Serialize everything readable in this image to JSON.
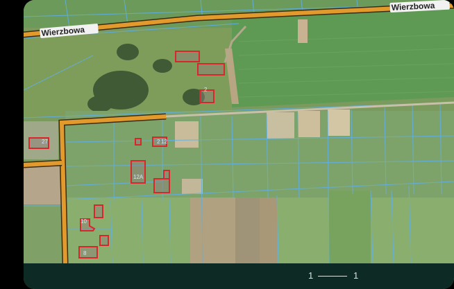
{
  "map": {
    "road_labels": [
      "Wierzbowa",
      "Wierzbowa"
    ],
    "building_numbers": [
      "2",
      "27",
      "2",
      "12",
      "12A",
      "10",
      "8"
    ]
  },
  "footer": {
    "scale_left": "1",
    "scale_right": "1"
  },
  "colors": {
    "road": "#e39a2c",
    "parcel_line": "#58a6d8",
    "building_outline": "#d8262b",
    "field": "#6f9a55",
    "footer_bg": "#0e2a24"
  }
}
